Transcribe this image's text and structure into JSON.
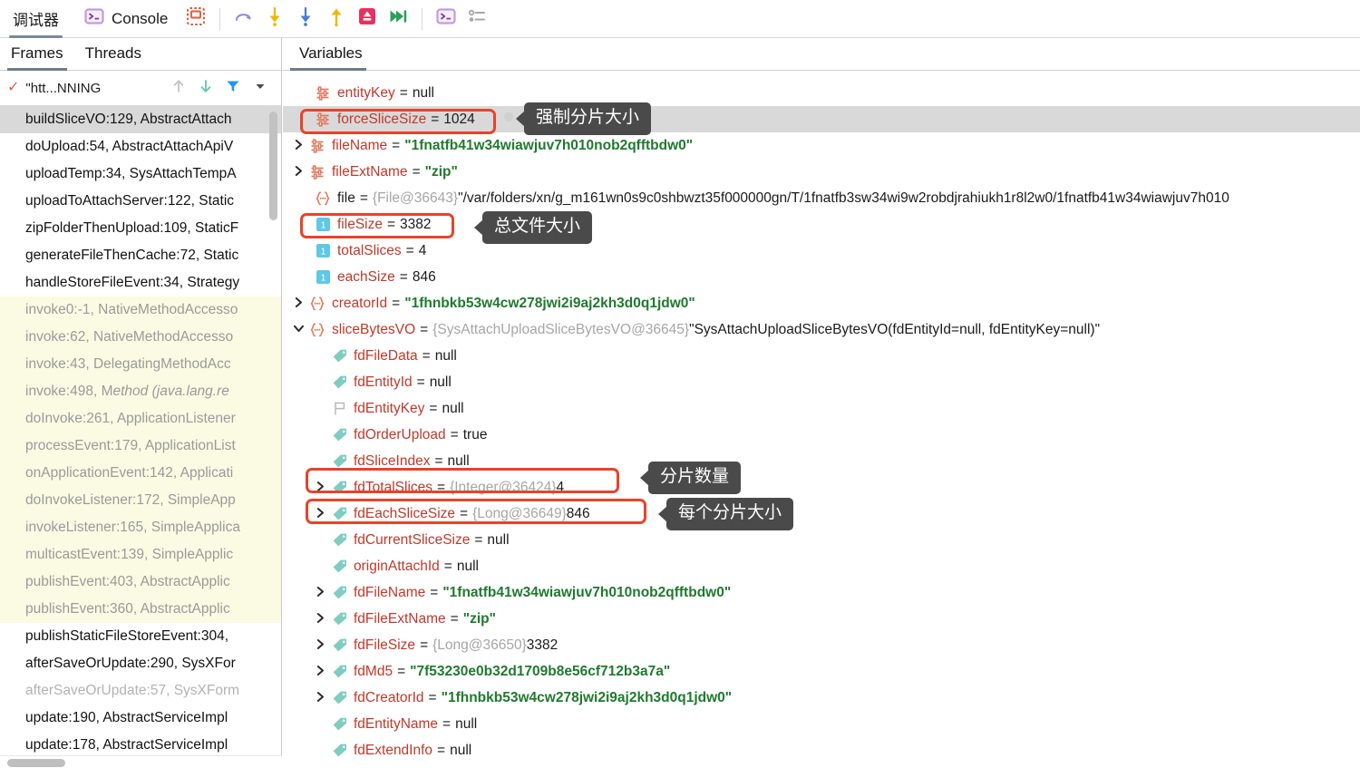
{
  "toolbar": {
    "tabs": [
      {
        "label": "调试器",
        "icon": "debugger-icon",
        "active": true
      },
      {
        "label": "Console",
        "icon": "console-icon",
        "active": false
      }
    ],
    "buttons": [
      {
        "name": "frames-layout-button",
        "icon": "frames-layout-icon"
      },
      {
        "name": "step-over-button",
        "icon": "step-over-icon"
      },
      {
        "name": "step-into-button",
        "icon": "step-into-icon"
      },
      {
        "name": "force-step-into-button",
        "icon": "force-step-into-icon"
      },
      {
        "name": "step-out-button",
        "icon": "step-out-icon"
      },
      {
        "name": "drop-frame-button",
        "icon": "drop-frame-icon"
      },
      {
        "name": "run-to-cursor-button",
        "icon": "run-to-cursor-icon"
      },
      {
        "name": "evaluate-expression-button",
        "icon": "evaluate-expression-icon"
      },
      {
        "name": "settings-list-button",
        "icon": "settings-list-icon"
      }
    ]
  },
  "left": {
    "tabs": [
      {
        "label": "Frames",
        "active": true
      },
      {
        "label": "Threads",
        "active": false
      }
    ],
    "thread_selector": {
      "label": "\"htt...NNING",
      "check_icon": "checkmark-icon",
      "up_icon": "arrow-up-icon",
      "down_icon": "arrow-down-icon",
      "filter_icon": "filter-icon",
      "dropdown_icon": "chevron-down-icon"
    },
    "frames": [
      {
        "text": "buildSliceVO:129, AbstractAttach",
        "style": "selected"
      },
      {
        "text": "doUpload:54, AbstractAttachApiV",
        "style": "normal"
      },
      {
        "text": "uploadTemp:34, SysAttachTempA",
        "style": "normal"
      },
      {
        "text": "uploadToAttachServer:122, Static",
        "style": "normal"
      },
      {
        "text": "zipFolderThenUpload:109, StaticF",
        "style": "normal"
      },
      {
        "text": "generateFileThenCache:72, Static",
        "style": "normal"
      },
      {
        "text": "handleStoreFileEvent:34, Strategy",
        "style": "normal"
      },
      {
        "text": "invoke0:-1, NativeMethodAccesso",
        "style": "lib"
      },
      {
        "text": "invoke:62, NativeMethodAccesso",
        "style": "lib"
      },
      {
        "text": "invoke:43, DelegatingMethodAcc",
        "style": "lib"
      },
      {
        "text": "invoke:498, Method (java.lang.re",
        "style": "lib",
        "italic_from": 13
      },
      {
        "text": "doInvoke:261, ApplicationListener",
        "style": "lib"
      },
      {
        "text": "processEvent:179, ApplicationList",
        "style": "lib"
      },
      {
        "text": "onApplicationEvent:142, Applicati",
        "style": "lib"
      },
      {
        "text": "doInvokeListener:172, SimpleApp",
        "style": "lib"
      },
      {
        "text": "invokeListener:165, SimpleApplica",
        "style": "lib"
      },
      {
        "text": "multicastEvent:139, SimpleApplic",
        "style": "lib"
      },
      {
        "text": "publishEvent:403, AbstractApplic",
        "style": "lib"
      },
      {
        "text": "publishEvent:360, AbstractApplic",
        "style": "lib"
      },
      {
        "text": "publishStaticFileStoreEvent:304,",
        "style": "normal"
      },
      {
        "text": "afterSaveOrUpdate:290, SysXFor",
        "style": "normal"
      },
      {
        "text": "afterSaveOrUpdate:57, SysXForm",
        "style": "lib-white"
      },
      {
        "text": "update:190, AbstractServiceImpl",
        "style": "normal"
      },
      {
        "text": "update:178, AbstractServiceImpl",
        "style": "normal"
      }
    ]
  },
  "right": {
    "tabs": [
      {
        "label": "Variables",
        "active": true
      }
    ],
    "variables": [
      {
        "chevron": "none",
        "icon": "parameter-icon",
        "indent": 1,
        "name": "entityKey",
        "eq": "=",
        "value": "null",
        "value_type": "null"
      },
      {
        "chevron": "none",
        "icon": "parameter-icon",
        "indent": 1,
        "name": "forceSliceSize",
        "eq": "=",
        "value": "1024",
        "value_type": "num",
        "highlight": true
      },
      {
        "chevron": "collapsed",
        "icon": "parameter-icon",
        "indent": 0,
        "name": "fileName",
        "eq": "=",
        "value": "\"1fnatfb41w34wiawjuv7h010nob2qfftbdw0\"",
        "value_type": "str"
      },
      {
        "chevron": "collapsed",
        "icon": "parameter-icon",
        "indent": 0,
        "name": "fileExtName",
        "eq": "=",
        "value": "\"zip\"",
        "value_type": "str"
      },
      {
        "chevron": "none",
        "icon": "object-icon",
        "indent": 1,
        "name": "file",
        "eq": "=",
        "ref": "{File@36643}",
        "value": "\"/var/folders/xn/g_m161wn0s9c0shbwzt35f000000gn/T/1fnatfb3sw34wi9w2robdjrahiukh1r8l2w0/1fnatfb41w34wiawjuv7h010",
        "value_type": "text",
        "name_color": "plain"
      },
      {
        "chevron": "none",
        "icon": "primitive-icon",
        "indent": 1,
        "name": "fileSize",
        "eq": "=",
        "value": "3382",
        "value_type": "num"
      },
      {
        "chevron": "none",
        "icon": "primitive-icon",
        "indent": 1,
        "name": "totalSlices",
        "eq": "=",
        "value": "4",
        "value_type": "num"
      },
      {
        "chevron": "none",
        "icon": "primitive-icon",
        "indent": 1,
        "name": "eachSize",
        "eq": "=",
        "value": "846",
        "value_type": "num"
      },
      {
        "chevron": "collapsed",
        "icon": "object-icon",
        "indent": 0,
        "name": "creatorId",
        "eq": "=",
        "value": "\"1fhnbkb53w4cw278jwi2i9aj2kh3d0q1jdw0\"",
        "value_type": "str"
      },
      {
        "chevron": "expanded",
        "icon": "object-icon",
        "indent": 0,
        "name": "sliceBytesVO",
        "eq": "=",
        "ref": "{SysAttachUploadSliceBytesVO@36645}",
        "value": "\"SysAttachUploadSliceBytesVO(fdEntityId=null, fdEntityKey=null)\"",
        "value_type": "text"
      },
      {
        "chevron": "none",
        "icon": "field-tag-icon",
        "indent": 2,
        "name": "fdFileData",
        "eq": "=",
        "value": "null",
        "value_type": "null"
      },
      {
        "chevron": "none",
        "icon": "field-tag-icon",
        "indent": 2,
        "name": "fdEntityId",
        "eq": "=",
        "value": "null",
        "value_type": "null"
      },
      {
        "chevron": "none",
        "icon": "flag-outline-icon",
        "indent": 2,
        "name": "fdEntityKey",
        "eq": "=",
        "value": "null",
        "value_type": "null"
      },
      {
        "chevron": "none",
        "icon": "field-tag-icon",
        "indent": 2,
        "name": "fdOrderUpload",
        "eq": "=",
        "value": "true",
        "value_type": "text"
      },
      {
        "chevron": "none",
        "icon": "field-tag-icon",
        "indent": 2,
        "name": "fdSliceIndex",
        "eq": "=",
        "value": "null",
        "value_type": "null"
      },
      {
        "chevron": "collapsed",
        "icon": "field-tag-icon",
        "indent": 2,
        "name": "fdTotalSlices",
        "eq": "=",
        "ref": "{Integer@36424}",
        "value": "4",
        "value_type": "num"
      },
      {
        "chevron": "collapsed",
        "icon": "field-tag-icon",
        "indent": 2,
        "name": "fdEachSliceSize",
        "eq": "=",
        "ref": "{Long@36649}",
        "value": "846",
        "value_type": "num"
      },
      {
        "chevron": "none",
        "icon": "field-tag-icon",
        "indent": 2,
        "name": "fdCurrentSliceSize",
        "eq": "=",
        "value": "null",
        "value_type": "null"
      },
      {
        "chevron": "none",
        "icon": "field-tag-icon",
        "indent": 2,
        "name": "originAttachId",
        "eq": "=",
        "value": "null",
        "value_type": "null"
      },
      {
        "chevron": "collapsed",
        "icon": "field-tag-icon",
        "indent": 2,
        "name": "fdFileName",
        "eq": "=",
        "value": "\"1fnatfb41w34wiawjuv7h010nob2qfftbdw0\"",
        "value_type": "str"
      },
      {
        "chevron": "collapsed",
        "icon": "field-tag-icon",
        "indent": 2,
        "name": "fdFileExtName",
        "eq": "=",
        "value": "\"zip\"",
        "value_type": "str"
      },
      {
        "chevron": "collapsed",
        "icon": "field-tag-icon",
        "indent": 2,
        "name": "fdFileSize",
        "eq": "=",
        "ref": "{Long@36650}",
        "value": "3382",
        "value_type": "num"
      },
      {
        "chevron": "collapsed",
        "icon": "field-tag-icon",
        "indent": 2,
        "name": "fdMd5",
        "eq": "=",
        "value": "\"7f53230e0b32d1709b8e56cf712b3a7a\"",
        "value_type": "str"
      },
      {
        "chevron": "collapsed",
        "icon": "field-tag-icon",
        "indent": 2,
        "name": "fdCreatorId",
        "eq": "=",
        "value": "\"1fhnbkb53w4cw278jwi2i9aj2kh3d0q1jdw0\"",
        "value_type": "str"
      },
      {
        "chevron": "none",
        "icon": "field-tag-icon",
        "indent": 2,
        "name": "fdEntityName",
        "eq": "=",
        "value": "null",
        "value_type": "null"
      },
      {
        "chevron": "none",
        "icon": "field-tag-icon",
        "indent": 2,
        "name": "fdExtendInfo",
        "eq": "=",
        "value": "null",
        "value_type": "null"
      }
    ]
  },
  "annotations": [
    {
      "name": "annotation-force-slice-size",
      "text": "强制分片大小"
    },
    {
      "name": "annotation-total-file-size",
      "text": "总文件大小"
    },
    {
      "name": "annotation-slice-count",
      "text": "分片数量"
    },
    {
      "name": "annotation-each-slice-size",
      "text": "每个分片大小"
    }
  ],
  "colors": {
    "highlight_box": "#e8432a",
    "callout_bg": "#4a4a4a",
    "string_green": "#1f7a2e",
    "name_red": "#c0392b",
    "selection_gray": "#d9d9d9",
    "lib_row_yellow": "#fbfbe4"
  }
}
